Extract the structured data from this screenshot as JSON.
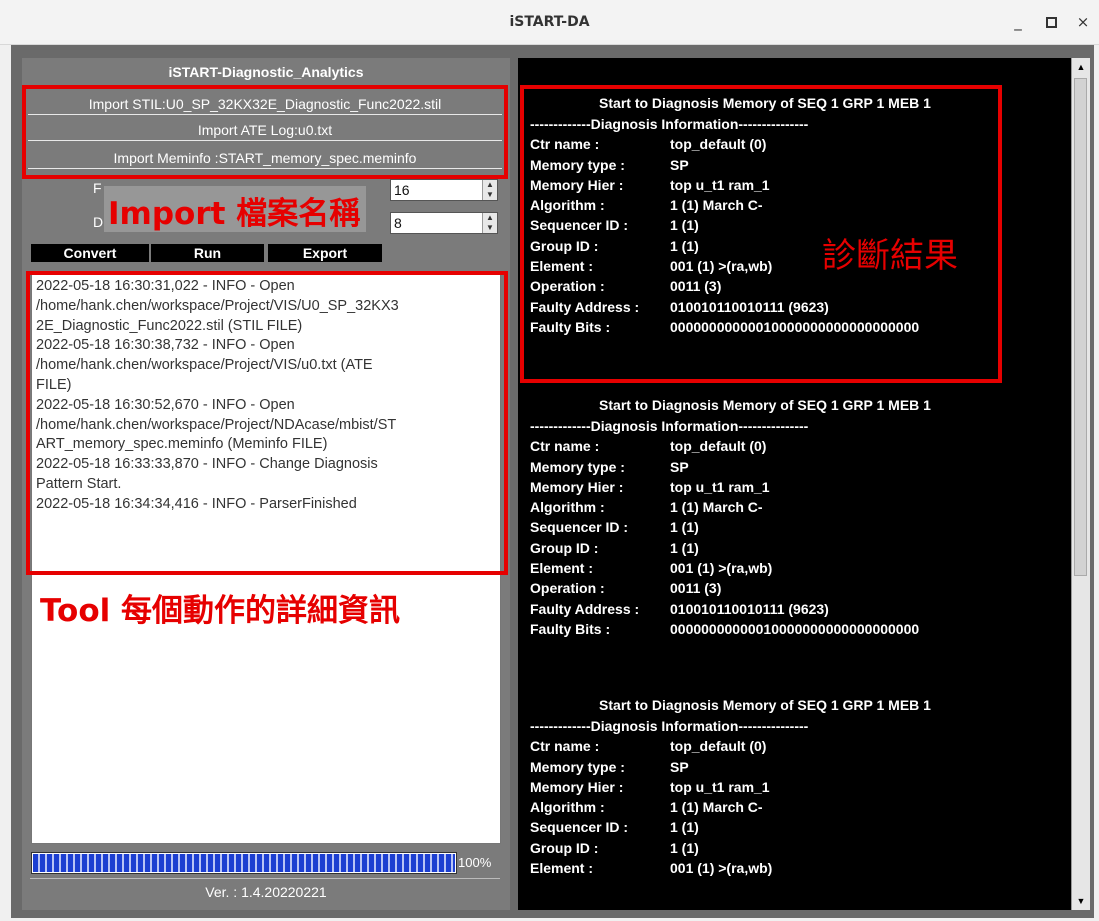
{
  "window": {
    "title": "iSTART-DA",
    "minimize_label": "_",
    "close_label": "×"
  },
  "left_panel": {
    "title": "iSTART-Diagnostic_Analytics",
    "imports": [
      "Import STIL:U0_SP_32KX32E_Diagnostic_Func2022.stil",
      "Import ATE Log:u0.txt",
      "Import Meminfo :START_memory_spec.meminfo"
    ],
    "fields": [
      {
        "label": "F",
        "value": "16"
      },
      {
        "label": "D",
        "value": "8"
      }
    ],
    "buttons": {
      "convert": "Convert",
      "run": "Run",
      "export": "Export"
    },
    "log_lines": [
      "2022-05-18 16:30:31,022 - INFO - Open",
      "/home/hank.chen/workspace/Project/VIS/U0_SP_32KX3",
      "2E_Diagnostic_Func2022.stil (STIL FILE)",
      "2022-05-18 16:30:38,732 - INFO - Open",
      "/home/hank.chen/workspace/Project/VIS/u0.txt (ATE",
      "FILE)",
      "2022-05-18 16:30:52,670 - INFO - Open",
      "/home/hank.chen/workspace/Project/NDAcase/mbist/ST",
      "ART_memory_spec.meminfo (Meminfo FILE)",
      "2022-05-18 16:33:33,870 - INFO - Change Diagnosis",
      "Pattern Start.",
      "2022-05-18 16:34:34,416 - INFO - ParserFinished"
    ],
    "progress": {
      "value": 1.0,
      "label": "100%"
    },
    "version": "Ver. : 1.4.20220221"
  },
  "results": [
    {
      "header": "Start to Diagnosis Memory of SEQ 1 GRP 1 MEB 1",
      "separator": "-------------Diagnosis Information---------------",
      "rows": [
        {
          "key": "Ctr name :",
          "value": "top_default (0)"
        },
        {
          "key": "Memory type :",
          "value": "SP"
        },
        {
          "key": "Memory Hier :",
          "value": "top u_t1 ram_1"
        },
        {
          "key": "Algorithm :",
          "value": "1 (1) March C-"
        },
        {
          "key": "Sequencer ID :",
          "value": "1 (1)"
        },
        {
          "key": "Group ID :",
          "value": "1 (1)"
        },
        {
          "key": "Element :",
          "value": "001 (1) >(ra,wb)"
        },
        {
          "key": "Operation :",
          "value": "0011 (3)"
        },
        {
          "key": "Faulty Address :",
          "value": "010010110010111 (9623)"
        },
        {
          "key": "Faulty Bits :",
          "value": "00000000000010000000000000000000"
        }
      ]
    },
    {
      "header": "Start to Diagnosis Memory of SEQ 1 GRP 1 MEB 1",
      "separator": "-------------Diagnosis Information---------------",
      "rows": [
        {
          "key": "Ctr name :",
          "value": "top_default (0)"
        },
        {
          "key": "Memory type :",
          "value": "SP"
        },
        {
          "key": "Memory Hier :",
          "value": "top u_t1 ram_1"
        },
        {
          "key": "Algorithm :",
          "value": "1 (1) March C-"
        },
        {
          "key": "Sequencer ID :",
          "value": "1 (1)"
        },
        {
          "key": "Group ID :",
          "value": "1 (1)"
        },
        {
          "key": "Element :",
          "value": "001 (1) >(ra,wb)"
        },
        {
          "key": "Operation :",
          "value": "0011 (3)"
        },
        {
          "key": "Faulty Address :",
          "value": "010010110010111 (9623)"
        },
        {
          "key": "Faulty Bits :",
          "value": "00000000000010000000000000000000"
        }
      ]
    },
    {
      "header": "Start to Diagnosis Memory of SEQ 1 GRP 1 MEB 1",
      "separator": "-------------Diagnosis Information---------------",
      "rows": [
        {
          "key": "Ctr name :",
          "value": "top_default (0)"
        },
        {
          "key": "Memory type :",
          "value": "SP"
        },
        {
          "key": "Memory Hier :",
          "value": "top u_t1 ram_1"
        },
        {
          "key": "Algorithm :",
          "value": "1 (1) March C-"
        },
        {
          "key": "Sequencer ID :",
          "value": "1 (1)"
        },
        {
          "key": "Group ID :",
          "value": "1 (1)"
        },
        {
          "key": "Element :",
          "value": "001 (1) >(ra,wb)"
        }
      ]
    }
  ],
  "annotations": {
    "import_label": "Import 檔案名稱",
    "result_label": "診斷結果",
    "log_label": "Tool 每個動作的詳細資訊",
    "color": "#e60000"
  },
  "colors": {
    "panel_gray": "#7b7b7b",
    "result_bg": "#000000",
    "progress_blue": "#1c3fd1"
  }
}
